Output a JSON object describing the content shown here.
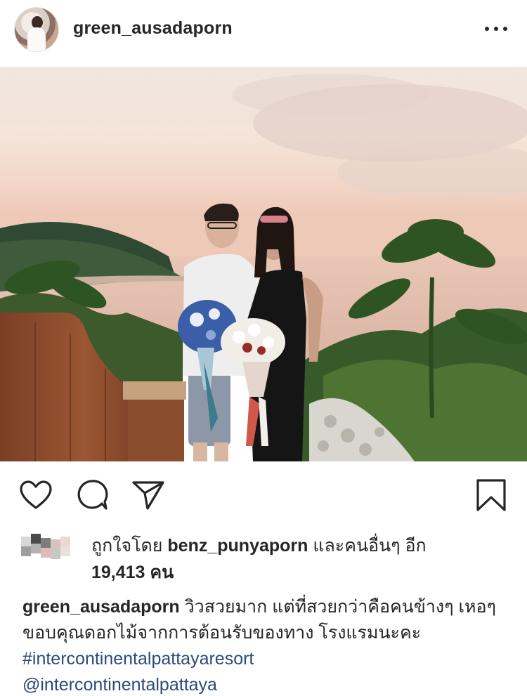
{
  "post": {
    "username": "green_ausadaporn",
    "more_icon": "more-dots-icon"
  },
  "actions": {
    "like_icon": "heart-icon",
    "comment_icon": "comment-icon",
    "share_icon": "send-icon",
    "save_icon": "bookmark-icon"
  },
  "likes": {
    "prefix": "ถูกใจโดย",
    "liker": "benz_punyaporn",
    "suffix": "และคนอื่นๆ อีก",
    "count": "19,413 คน"
  },
  "caption": {
    "username": "green_ausadaporn",
    "text": "วิวสวยมาก แต่ที่สวยกว่าคือคนข้างๆ เหอๆ ขอบคุณดอกไม้จากการต้อนรับของทาง โรงแรมนะคะ",
    "hashtag": "#intercontinentalpattayaresort",
    "mention": "@intercontinentalpattaya"
  },
  "colors": {
    "text": "#262626",
    "link": "#2a4a7a",
    "background": "#ffffff"
  }
}
